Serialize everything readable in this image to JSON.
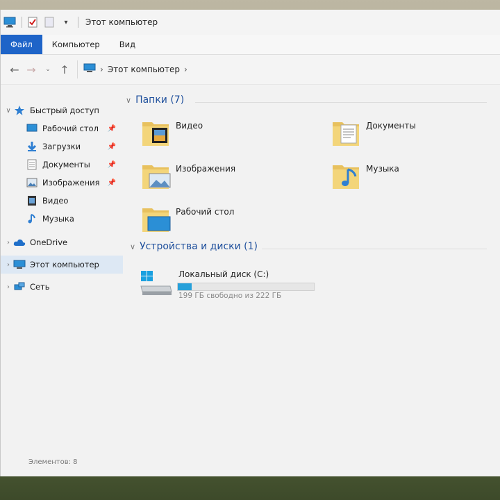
{
  "window": {
    "title": "Этот компьютер"
  },
  "ribbon": {
    "tabs": [
      "Файл",
      "Компьютер",
      "Вид"
    ]
  },
  "address": {
    "crumb": "Этот компьютер"
  },
  "sidebar": {
    "items": [
      {
        "label": "Быстрый доступ",
        "icon": "star-icon"
      },
      {
        "label": "Рабочий стол",
        "icon": "desktop-icon"
      },
      {
        "label": "Загрузки",
        "icon": "download-icon"
      },
      {
        "label": "Документы",
        "icon": "documents-icon"
      },
      {
        "label": "Изображения",
        "icon": "images-icon"
      },
      {
        "label": "Видео",
        "icon": "video-icon"
      },
      {
        "label": "Музыка",
        "icon": "music-icon"
      },
      {
        "label": "OneDrive",
        "icon": "cloud-icon"
      },
      {
        "label": "Этот компьютер",
        "icon": "computer-icon"
      },
      {
        "label": "Сеть",
        "icon": "network-icon"
      }
    ]
  },
  "groups": {
    "folders": {
      "header": "Папки (7)"
    },
    "devices": {
      "header": "Устройства и диски (1)"
    }
  },
  "folders": [
    {
      "label": "Видео",
      "icon": "video-folder-icon"
    },
    {
      "label": "Документы",
      "icon": "documents-folder-icon"
    },
    {
      "label": "Изображения",
      "icon": "images-folder-icon"
    },
    {
      "label": "Музыка",
      "icon": "music-folder-icon"
    },
    {
      "label": "Рабочий стол",
      "icon": "desktop-folder-icon"
    }
  ],
  "drive": {
    "name": "Локальный диск (C:)",
    "free_text": "199 ГБ свободно из 222 ГБ",
    "used_fraction": 0.1,
    "accent": "#26a0da"
  },
  "status": {
    "items": "Элементов: 8"
  },
  "colors": {
    "file_tab": "#1e64c8",
    "group_header": "#1e4f9c"
  }
}
